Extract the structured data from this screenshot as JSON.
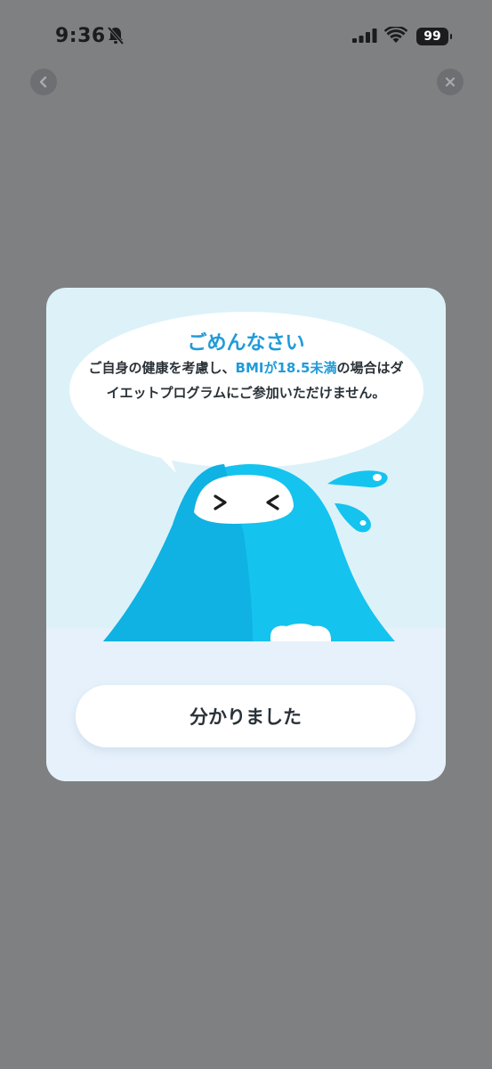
{
  "status_bar": {
    "time": "9:36",
    "battery": "99",
    "icons": [
      "bell-slash-icon",
      "signal-icon",
      "wifi-icon",
      "battery-icon"
    ]
  },
  "nav": {
    "back_icon": "chevron-left-icon",
    "close_icon": "close-icon"
  },
  "dialog": {
    "title": "ごめんなさい",
    "message_prefix": "ご自身の健康を考慮し、",
    "message_highlight": "BMIが18.5未満",
    "message_suffix": "の場合はダイエットプログラムにご参加いただけません。",
    "button_label": "分かりました"
  },
  "colors": {
    "accent": "#1f9bd9",
    "overlay": "#7f8082",
    "mascot": "#15c3ef"
  }
}
